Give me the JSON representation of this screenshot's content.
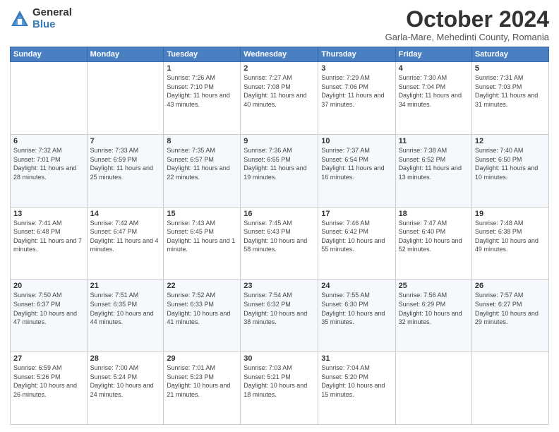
{
  "logo": {
    "general": "General",
    "blue": "Blue"
  },
  "header": {
    "title": "October 2024",
    "location": "Garla-Mare, Mehedinti County, Romania"
  },
  "weekdays": [
    "Sunday",
    "Monday",
    "Tuesday",
    "Wednesday",
    "Thursday",
    "Friday",
    "Saturday"
  ],
  "weeks": [
    [
      {
        "day": "",
        "sunrise": "",
        "sunset": "",
        "daylight": ""
      },
      {
        "day": "",
        "sunrise": "",
        "sunset": "",
        "daylight": ""
      },
      {
        "day": "1",
        "sunrise": "Sunrise: 7:26 AM",
        "sunset": "Sunset: 7:10 PM",
        "daylight": "Daylight: 11 hours and 43 minutes."
      },
      {
        "day": "2",
        "sunrise": "Sunrise: 7:27 AM",
        "sunset": "Sunset: 7:08 PM",
        "daylight": "Daylight: 11 hours and 40 minutes."
      },
      {
        "day": "3",
        "sunrise": "Sunrise: 7:29 AM",
        "sunset": "Sunset: 7:06 PM",
        "daylight": "Daylight: 11 hours and 37 minutes."
      },
      {
        "day": "4",
        "sunrise": "Sunrise: 7:30 AM",
        "sunset": "Sunset: 7:04 PM",
        "daylight": "Daylight: 11 hours and 34 minutes."
      },
      {
        "day": "5",
        "sunrise": "Sunrise: 7:31 AM",
        "sunset": "Sunset: 7:03 PM",
        "daylight": "Daylight: 11 hours and 31 minutes."
      }
    ],
    [
      {
        "day": "6",
        "sunrise": "Sunrise: 7:32 AM",
        "sunset": "Sunset: 7:01 PM",
        "daylight": "Daylight: 11 hours and 28 minutes."
      },
      {
        "day": "7",
        "sunrise": "Sunrise: 7:33 AM",
        "sunset": "Sunset: 6:59 PM",
        "daylight": "Daylight: 11 hours and 25 minutes."
      },
      {
        "day": "8",
        "sunrise": "Sunrise: 7:35 AM",
        "sunset": "Sunset: 6:57 PM",
        "daylight": "Daylight: 11 hours and 22 minutes."
      },
      {
        "day": "9",
        "sunrise": "Sunrise: 7:36 AM",
        "sunset": "Sunset: 6:55 PM",
        "daylight": "Daylight: 11 hours and 19 minutes."
      },
      {
        "day": "10",
        "sunrise": "Sunrise: 7:37 AM",
        "sunset": "Sunset: 6:54 PM",
        "daylight": "Daylight: 11 hours and 16 minutes."
      },
      {
        "day": "11",
        "sunrise": "Sunrise: 7:38 AM",
        "sunset": "Sunset: 6:52 PM",
        "daylight": "Daylight: 11 hours and 13 minutes."
      },
      {
        "day": "12",
        "sunrise": "Sunrise: 7:40 AM",
        "sunset": "Sunset: 6:50 PM",
        "daylight": "Daylight: 11 hours and 10 minutes."
      }
    ],
    [
      {
        "day": "13",
        "sunrise": "Sunrise: 7:41 AM",
        "sunset": "Sunset: 6:48 PM",
        "daylight": "Daylight: 11 hours and 7 minutes."
      },
      {
        "day": "14",
        "sunrise": "Sunrise: 7:42 AM",
        "sunset": "Sunset: 6:47 PM",
        "daylight": "Daylight: 11 hours and 4 minutes."
      },
      {
        "day": "15",
        "sunrise": "Sunrise: 7:43 AM",
        "sunset": "Sunset: 6:45 PM",
        "daylight": "Daylight: 11 hours and 1 minute."
      },
      {
        "day": "16",
        "sunrise": "Sunrise: 7:45 AM",
        "sunset": "Sunset: 6:43 PM",
        "daylight": "Daylight: 10 hours and 58 minutes."
      },
      {
        "day": "17",
        "sunrise": "Sunrise: 7:46 AM",
        "sunset": "Sunset: 6:42 PM",
        "daylight": "Daylight: 10 hours and 55 minutes."
      },
      {
        "day": "18",
        "sunrise": "Sunrise: 7:47 AM",
        "sunset": "Sunset: 6:40 PM",
        "daylight": "Daylight: 10 hours and 52 minutes."
      },
      {
        "day": "19",
        "sunrise": "Sunrise: 7:48 AM",
        "sunset": "Sunset: 6:38 PM",
        "daylight": "Daylight: 10 hours and 49 minutes."
      }
    ],
    [
      {
        "day": "20",
        "sunrise": "Sunrise: 7:50 AM",
        "sunset": "Sunset: 6:37 PM",
        "daylight": "Daylight: 10 hours and 47 minutes."
      },
      {
        "day": "21",
        "sunrise": "Sunrise: 7:51 AM",
        "sunset": "Sunset: 6:35 PM",
        "daylight": "Daylight: 10 hours and 44 minutes."
      },
      {
        "day": "22",
        "sunrise": "Sunrise: 7:52 AM",
        "sunset": "Sunset: 6:33 PM",
        "daylight": "Daylight: 10 hours and 41 minutes."
      },
      {
        "day": "23",
        "sunrise": "Sunrise: 7:54 AM",
        "sunset": "Sunset: 6:32 PM",
        "daylight": "Daylight: 10 hours and 38 minutes."
      },
      {
        "day": "24",
        "sunrise": "Sunrise: 7:55 AM",
        "sunset": "Sunset: 6:30 PM",
        "daylight": "Daylight: 10 hours and 35 minutes."
      },
      {
        "day": "25",
        "sunrise": "Sunrise: 7:56 AM",
        "sunset": "Sunset: 6:29 PM",
        "daylight": "Daylight: 10 hours and 32 minutes."
      },
      {
        "day": "26",
        "sunrise": "Sunrise: 7:57 AM",
        "sunset": "Sunset: 6:27 PM",
        "daylight": "Daylight: 10 hours and 29 minutes."
      }
    ],
    [
      {
        "day": "27",
        "sunrise": "Sunrise: 6:59 AM",
        "sunset": "Sunset: 5:26 PM",
        "daylight": "Daylight: 10 hours and 26 minutes."
      },
      {
        "day": "28",
        "sunrise": "Sunrise: 7:00 AM",
        "sunset": "Sunset: 5:24 PM",
        "daylight": "Daylight: 10 hours and 24 minutes."
      },
      {
        "day": "29",
        "sunrise": "Sunrise: 7:01 AM",
        "sunset": "Sunset: 5:23 PM",
        "daylight": "Daylight: 10 hours and 21 minutes."
      },
      {
        "day": "30",
        "sunrise": "Sunrise: 7:03 AM",
        "sunset": "Sunset: 5:21 PM",
        "daylight": "Daylight: 10 hours and 18 minutes."
      },
      {
        "day": "31",
        "sunrise": "Sunrise: 7:04 AM",
        "sunset": "Sunset: 5:20 PM",
        "daylight": "Daylight: 10 hours and 15 minutes."
      },
      {
        "day": "",
        "sunrise": "",
        "sunset": "",
        "daylight": ""
      },
      {
        "day": "",
        "sunrise": "",
        "sunset": "",
        "daylight": ""
      }
    ]
  ]
}
